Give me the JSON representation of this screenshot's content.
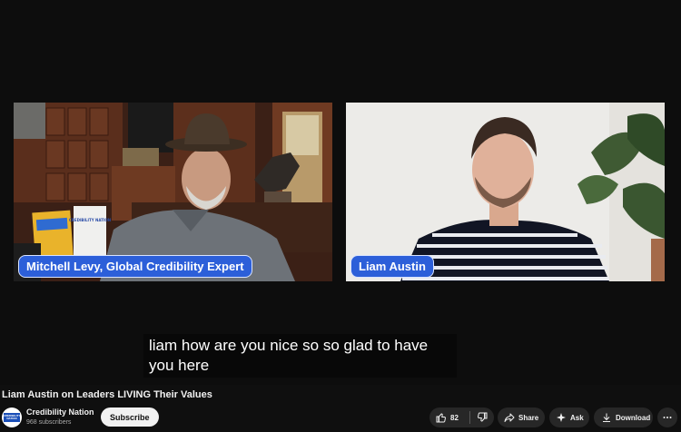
{
  "video": {
    "left_speaker": "Mitchell Levy, Global Credibility Expert",
    "right_speaker": "Liam Austin",
    "book_title": "CREDIBILITY NATION",
    "caption_line1": "liam how are you nice so so glad to have",
    "caption_line2": "you here"
  },
  "info": {
    "title": "Liam Austin on Leaders LIVING Their Values",
    "channel_name": "Credibility Nation",
    "subscribers": "968 subscribers",
    "subscribe_label": "Subscribe",
    "avatar_text": "CREDIBILITY NATION"
  },
  "actions": {
    "like_count": "82",
    "share_label": "Share",
    "ask_label": "Ask",
    "download_label": "Download"
  },
  "icons": [
    "thumbs-up-icon",
    "thumbs-down-icon",
    "share-icon",
    "sparkle-icon",
    "download-icon",
    "more-icon"
  ],
  "colors": {
    "name_tag": "#2c5fd9",
    "background": "#0f0f0f",
    "pill": "#272727"
  }
}
